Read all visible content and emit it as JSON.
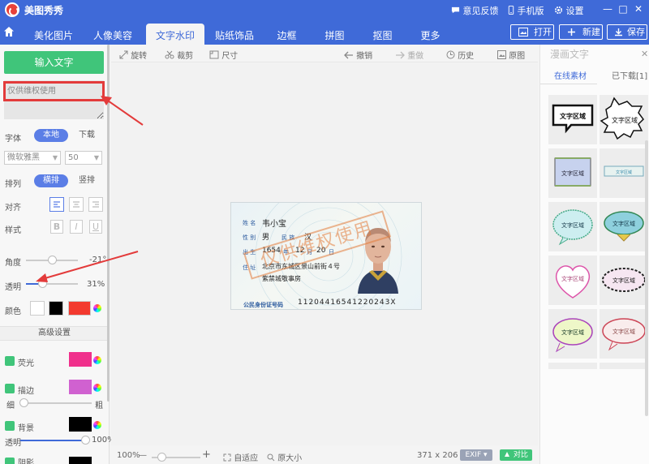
{
  "titlebar": {
    "app_title": "美图秀秀",
    "feedback": "意见反馈",
    "mobile": "手机版",
    "settings": "设置",
    "minimize": "—",
    "maximize": "□",
    "close": "✕"
  },
  "tabs": [
    {
      "label": "美化图片"
    },
    {
      "label": "人像美容"
    },
    {
      "label": "文字水印"
    },
    {
      "label": "贴纸饰品"
    },
    {
      "label": "边框"
    },
    {
      "label": "拼图"
    },
    {
      "label": "抠图"
    },
    {
      "label": "更多"
    }
  ],
  "topbuttons": {
    "open": "打开",
    "new": "新建",
    "save": "保存"
  },
  "left": {
    "add_text": "输入文字",
    "text_value": "仅供维权使用",
    "font_label": "字体",
    "font_local": "本地",
    "font_download": "下载",
    "font_name": "微软雅黑",
    "font_size": "50",
    "layout_label": "排列",
    "layout_horizontal": "横排",
    "layout_vertical": "竖排",
    "align_label": "对齐",
    "style_label": "样式",
    "style_bold": "B",
    "style_italic": "I",
    "style_underline": "U",
    "angle_label": "角度",
    "angle_value": "-21°",
    "angle_level": 0.5,
    "opacity_label": "透明",
    "opacity_value": "31%",
    "opacity_level": 0.31,
    "color_label": "颜色",
    "advanced": "高级设置",
    "glow_label": "荧光",
    "stroke_label": "描边",
    "stroke_thin": "细",
    "stroke_thick": "粗",
    "stroke_level": 0.05,
    "background_label": "背景",
    "bg_opacity_label": "透明",
    "bg_opacity_value": "100%",
    "bg_opacity_level": 1.0,
    "shadow_label": "阴影",
    "colors": {
      "swatch_white": "#ffffff",
      "swatch_black": "#000000",
      "swatch_red": "#f33a2f",
      "glow": "#f0308c",
      "stroke": "#d061d0",
      "background": "#000000"
    }
  },
  "canvastools": {
    "rotate": "旋转",
    "crop": "裁剪",
    "size": "尺寸",
    "undo": "撤销",
    "redo": "重做",
    "history": "历史",
    "original": "原图"
  },
  "idcard": {
    "name_label": "姓 名",
    "name_value": "韦小宝",
    "sex_label": "性 别",
    "sex_value": "男",
    "ethnic_label": "民 族",
    "ethnic_value": "汉",
    "birth_label": "出 生",
    "birth_year": "1654",
    "year_unit": "年",
    "birth_month": "12",
    "month_unit": "月",
    "birth_day": "20",
    "day_unit": "日",
    "address_label": "住 址",
    "address_line1": "北京市东城区景山前街４号",
    "address_line2": "紫禁城敬事房",
    "id_label": "公民身份证号码",
    "id_value": "11204416541220243X",
    "watermark": "仅供维权使用"
  },
  "statusbar": {
    "zoom": "100%",
    "minus": "—",
    "plus": "+",
    "zoom_level": 0.2,
    "fit": "自适应",
    "actual": "原大小",
    "dimensions": "371 x 206",
    "exif": "EXIF",
    "compare": "对比"
  },
  "right": {
    "title": "漫画文字",
    "tab_online": "在线素材",
    "tab_downloaded": "已下载[1]",
    "sticker_text": "文字区域"
  }
}
